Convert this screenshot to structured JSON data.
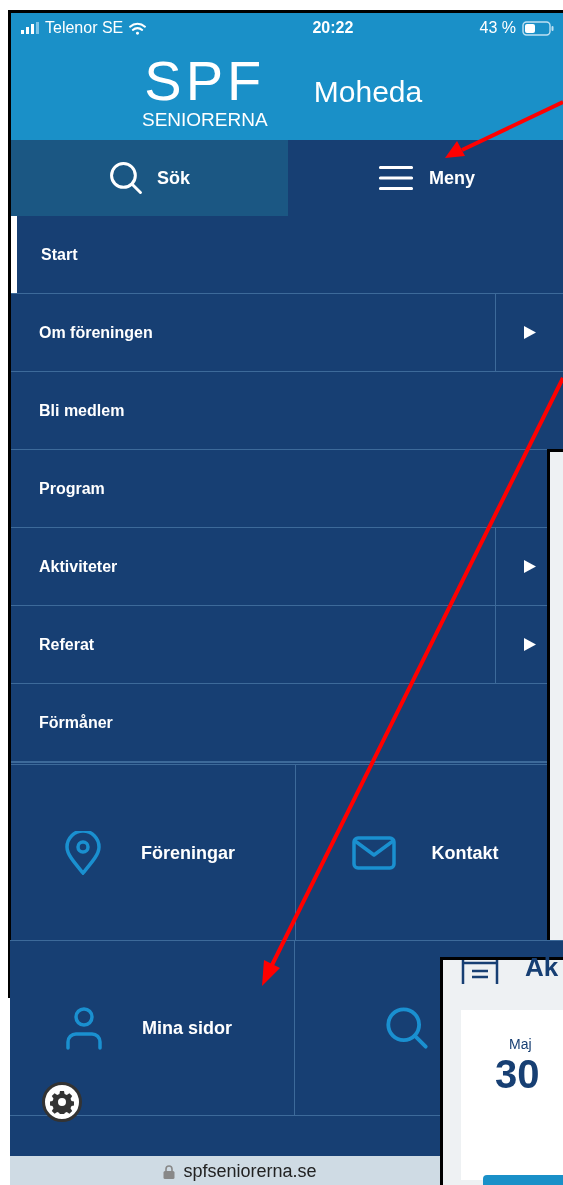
{
  "status_bar": {
    "carrier": "Telenor SE",
    "time": "20:22",
    "battery": "43 %"
  },
  "header": {
    "logo_letters": "SPF",
    "logo_word": "SENIORERNA",
    "site_name": "Moheda"
  },
  "tabs": [
    {
      "kind": "search",
      "label": "Sök",
      "selected": false
    },
    {
      "kind": "menu",
      "label": "Meny",
      "selected": true
    }
  ],
  "menu_items": [
    {
      "label": "Start",
      "selected": true,
      "has_submenu": false
    },
    {
      "label": "Om föreningen",
      "selected": false,
      "has_submenu": true
    },
    {
      "label": "Bli medlem",
      "selected": false,
      "has_submenu": false
    },
    {
      "label": "Program",
      "selected": false,
      "has_submenu": false
    },
    {
      "label": "Aktiviteter",
      "selected": false,
      "has_submenu": true
    },
    {
      "label": "Referat",
      "selected": false,
      "has_submenu": true
    },
    {
      "label": "Förmåner",
      "selected": false,
      "has_submenu": false
    }
  ],
  "tiles": [
    {
      "kind": "pin",
      "label": "Föreningar"
    },
    {
      "kind": "mail",
      "label": "Kontakt"
    }
  ],
  "scrolled_view": {
    "tiles": [
      {
        "kind": "person",
        "label": "Mina sidor"
      },
      {
        "kind": "search"
      }
    ],
    "address": "spfseniorerna.se"
  },
  "overlay_view": {
    "heading": "Ak",
    "date_month": "Maj",
    "date_day": "30"
  }
}
